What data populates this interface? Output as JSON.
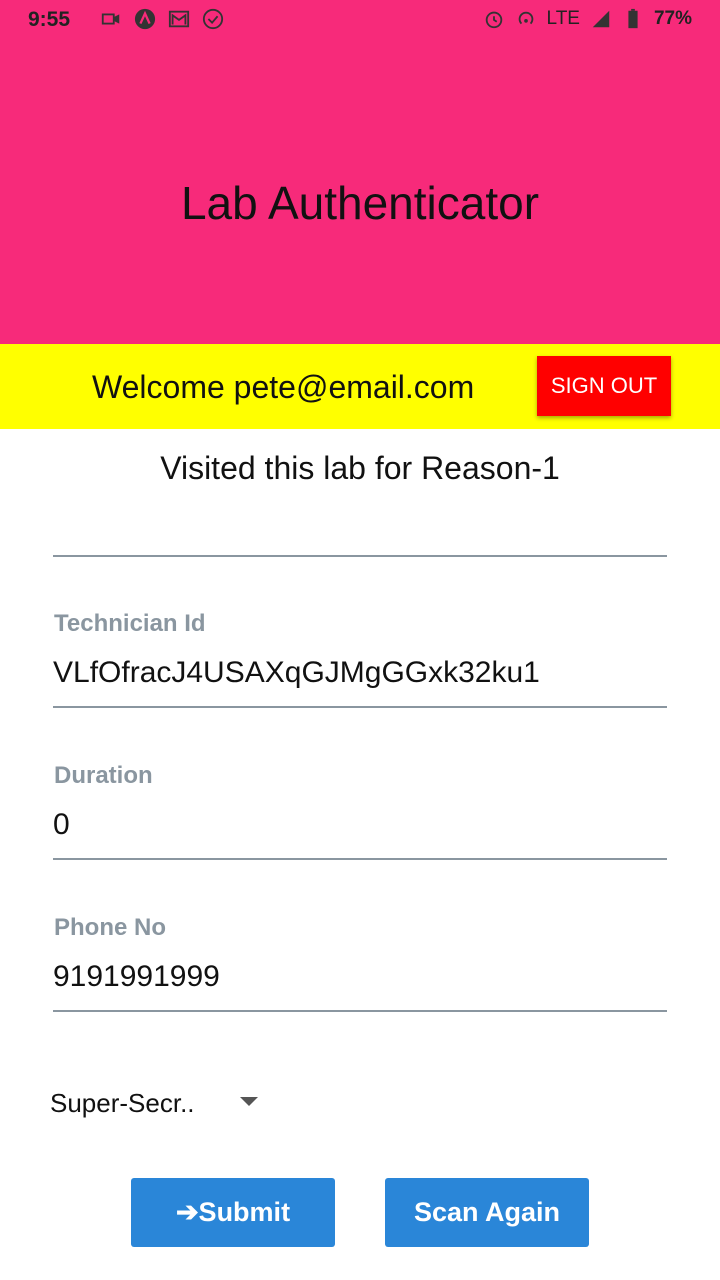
{
  "status_bar": {
    "time": "9:55",
    "network": "LTE",
    "battery": "77%",
    "icons_left": [
      "video-icon",
      "app-a-icon",
      "gmail-icon",
      "check-circle-icon"
    ],
    "icons_right": [
      "alarm-icon",
      "hotspot-icon",
      "signal-icon",
      "battery-icon"
    ]
  },
  "header": {
    "title": "Lab Authenticator",
    "bg_color": "#f72a7a"
  },
  "welcome_bar": {
    "text": "Welcome pete@email.com",
    "sign_out_label": "SIGN OUT",
    "bg_color": "#ffff00",
    "button_color": "#ff0000"
  },
  "main": {
    "visited_text": "Visited this lab for Reason-1",
    "fields": [
      {
        "label": "Technician Id",
        "value": "VLfOfracJ4USAXqGJMgGGxk32ku1"
      },
      {
        "label": "Duration",
        "value": "0"
      },
      {
        "label": "Phone No",
        "value": "9191991999"
      }
    ],
    "dropdown": {
      "selected": "Super-Secr.."
    },
    "buttons": {
      "submit_label": "➔Submit",
      "scan_again_label": "Scan Again",
      "color": "#2a86d8"
    }
  }
}
